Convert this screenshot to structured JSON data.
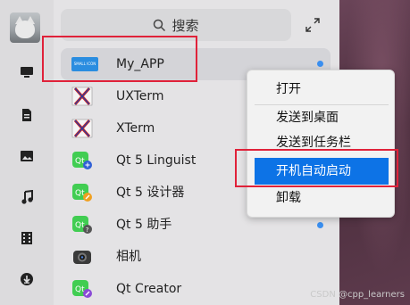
{
  "search": {
    "placeholder": "搜索"
  },
  "apps": [
    {
      "label": "My_APP",
      "badge_text": "SMALL ICON",
      "new": true
    },
    {
      "label": "UXTerm"
    },
    {
      "label": "XTerm"
    },
    {
      "label": "Qt 5 Linguist"
    },
    {
      "label": "Qt 5 设计器"
    },
    {
      "label": "Qt 5 助手",
      "new": true
    },
    {
      "label": "相机"
    },
    {
      "label": "Qt Creator"
    }
  ],
  "context_menu": {
    "items": [
      "打开",
      "发送到桌面",
      "发送到任务栏",
      "开机自动启动",
      "卸载"
    ],
    "active_index": 3
  },
  "sidebar_icons": [
    "computer-icon",
    "document-icon",
    "image-icon",
    "music-icon",
    "video-icon",
    "download-icon"
  ],
  "watermark": "CSDN @cpp_learners",
  "colors": {
    "accent": "#0d73e6",
    "highlight_border": "#e0223a",
    "new_dot": "#3a8ff0"
  }
}
